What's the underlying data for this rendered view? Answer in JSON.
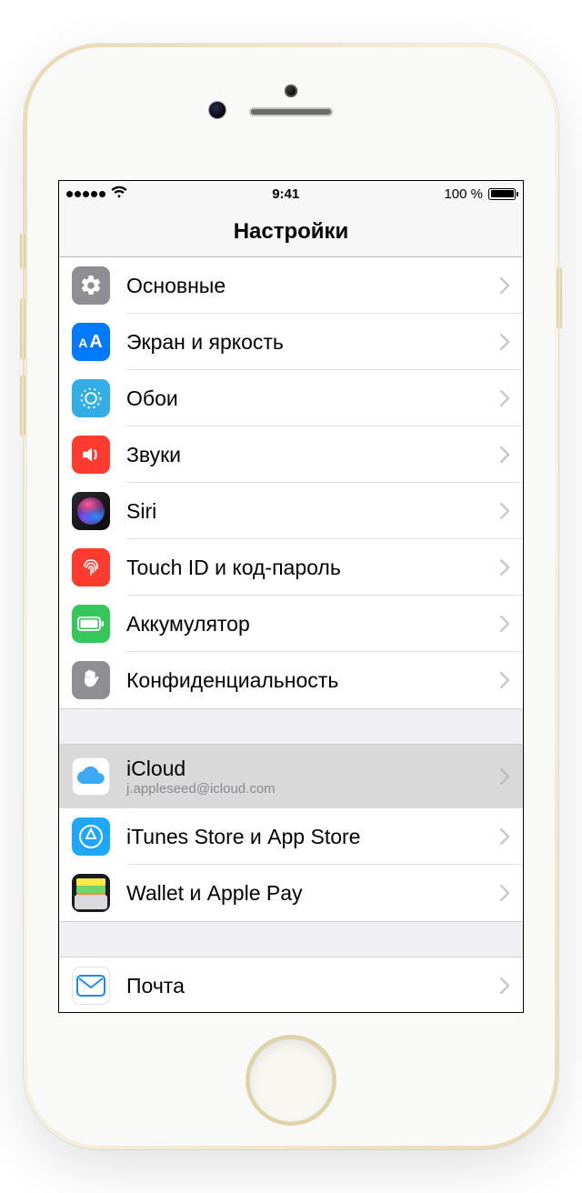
{
  "status": {
    "time": "9:41",
    "battery_pct": "100 %"
  },
  "header": {
    "title": "Настройки"
  },
  "groups": [
    {
      "rows": [
        {
          "key": "general",
          "label": "Основные"
        },
        {
          "key": "display",
          "label": "Экран и яркость"
        },
        {
          "key": "wallpaper",
          "label": "Обои"
        },
        {
          "key": "sounds",
          "label": "Звуки"
        },
        {
          "key": "siri",
          "label": "Siri"
        },
        {
          "key": "touchid",
          "label": "Touch ID и код-пароль"
        },
        {
          "key": "battery",
          "label": "Аккумулятор"
        },
        {
          "key": "privacy",
          "label": "Конфиденциальность"
        }
      ]
    },
    {
      "rows": [
        {
          "key": "icloud",
          "label": "iCloud",
          "sublabel": "j.appleseed@icloud.com",
          "selected": true
        },
        {
          "key": "itunes",
          "label": "iTunes Store и App Store"
        },
        {
          "key": "wallet",
          "label": "Wallet и Apple Pay"
        }
      ]
    },
    {
      "rows": [
        {
          "key": "mail",
          "label": "Почта"
        }
      ]
    }
  ]
}
